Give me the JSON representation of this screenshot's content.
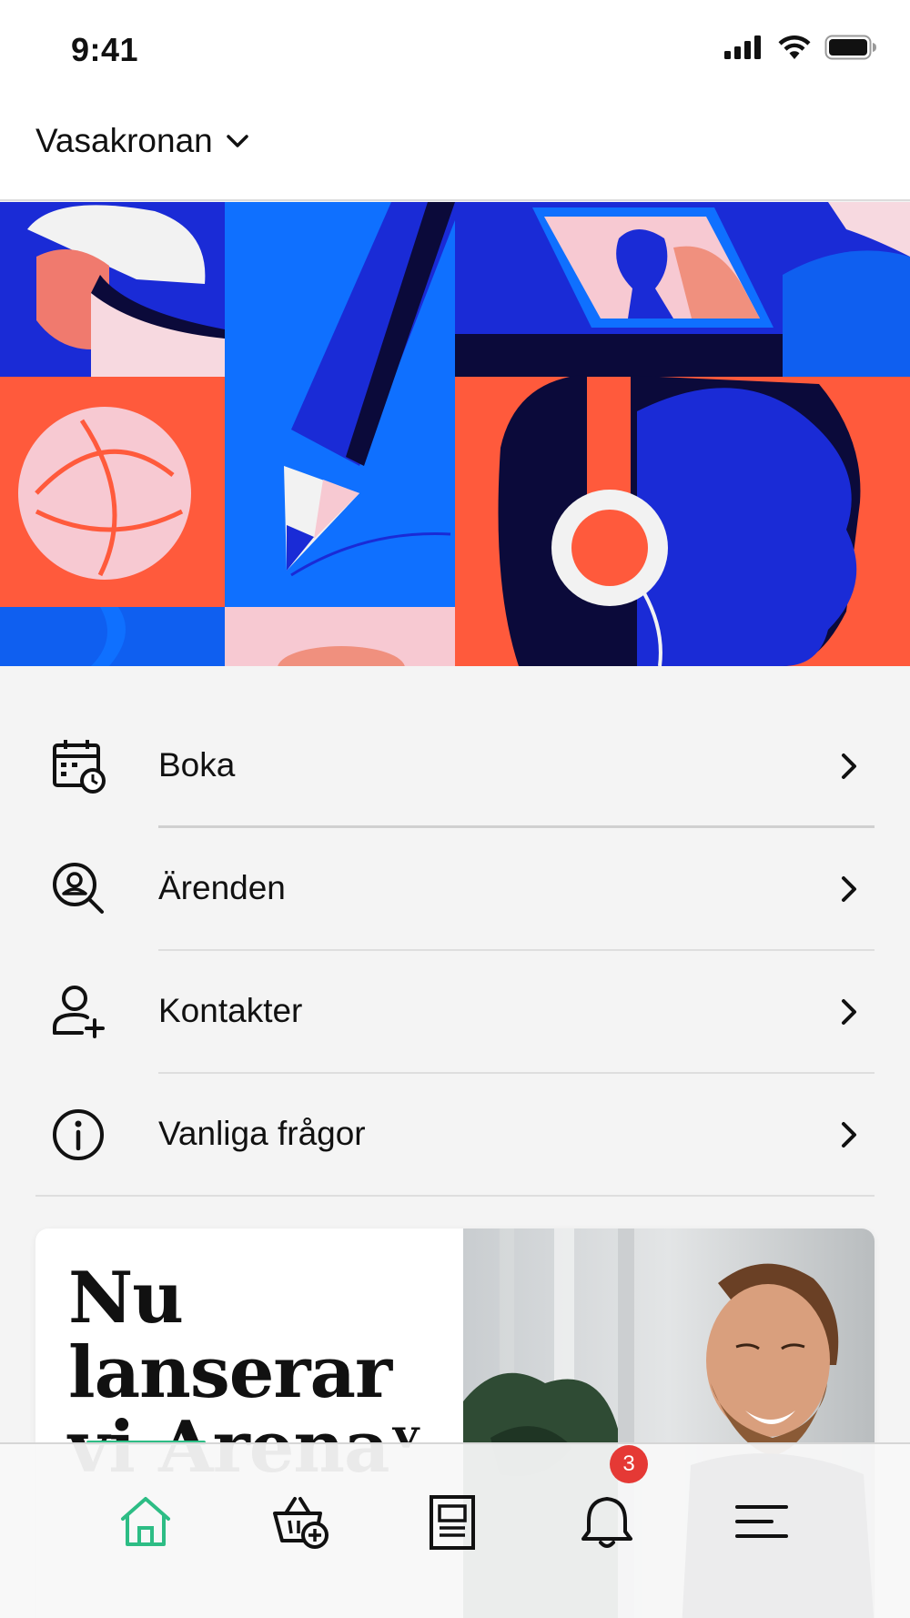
{
  "status_bar": {
    "time": "9:41",
    "signal_icon": "cellular-signal-icon",
    "wifi_icon": "wifi-icon",
    "battery_icon": "battery-icon"
  },
  "header": {
    "organization": "Vasakronan",
    "dropdown_icon": "chevron-down-icon"
  },
  "hero": {
    "image": "illustration-collage"
  },
  "menu": {
    "items": [
      {
        "label": "Boka",
        "icon": "calendar-clock-icon"
      },
      {
        "label": "Ärenden",
        "icon": "person-search-icon"
      },
      {
        "label": "Kontakter",
        "icon": "add-person-icon"
      },
      {
        "label": "Vanliga frågor",
        "icon": "info-icon"
      }
    ],
    "chevron_icon": "chevron-right-icon"
  },
  "promo": {
    "title_line1": "Nu lanserar",
    "title_line2": "vi Arena",
    "title_mark": "ᵛ"
  },
  "tabbar": {
    "tabs": [
      {
        "name": "home",
        "icon": "home-icon",
        "active": true
      },
      {
        "name": "shop",
        "icon": "basket-add-icon"
      },
      {
        "name": "news",
        "icon": "news-icon"
      },
      {
        "name": "notifications",
        "icon": "bell-icon"
      },
      {
        "name": "menu",
        "icon": "hamburger-menu-icon"
      }
    ],
    "notification_count": "3",
    "accent_color": "#2dbd85",
    "badge_color": "#e53935"
  }
}
